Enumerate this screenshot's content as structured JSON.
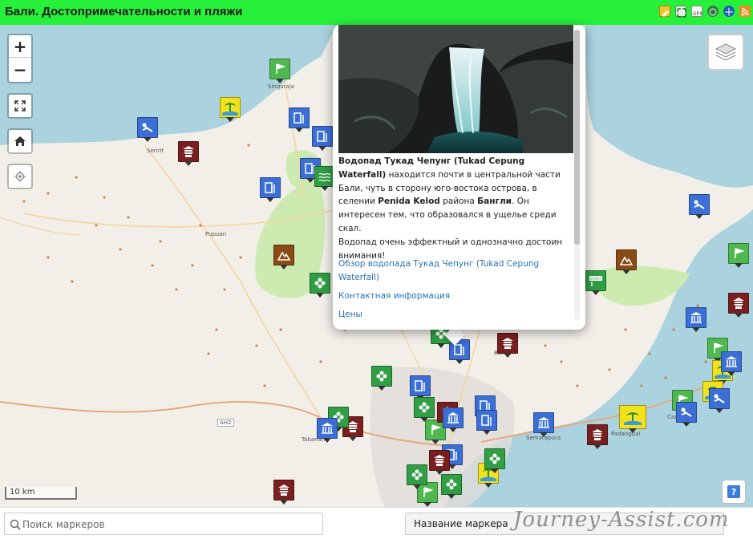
{
  "header": {
    "title": "Бали. Достопримечательности и пляжи",
    "icons": [
      "edit-icon",
      "fullscreen-icon",
      "gpx-icon",
      "globe-icon",
      "earth-icon",
      "rss-icon"
    ],
    "background": "#27f03a"
  },
  "map": {
    "controls": {
      "zoom_in": "+",
      "zoom_out": "−"
    },
    "scale_label": "10 km",
    "help_label": "?",
    "towns": [
      "Singaraja",
      "Seririt",
      "Pupuan",
      "Tabanan",
      "Bangli",
      "Semarapura",
      "Padangbai",
      "Candidasa",
      "AH2"
    ],
    "marker_categories": {
      "waterfall": "#3b6fd6",
      "temple": "#7a1f1f",
      "viewpoint": "#8a4a16",
      "flower": "#2f9e44",
      "flag": "#4fb84f",
      "diving": "#3b6fd6",
      "beach": "#f1e21b",
      "museum": "#3b6fd6"
    }
  },
  "popup": {
    "title_bold": "Водопад Тукад Чепунг (Tukad Cepung Waterfall)",
    "text_1": "находится почти в центральной части Бали, чуть в сторону юго-востока острова, в селении ",
    "village": "Penida Kelod",
    "text_2": " района ",
    "district": "Бангли",
    "text_3": ". Он интересен тем, что образовался в ущелье среди скал.",
    "text_4": "Водопад очень эффектный и однозначно достоин внимания!",
    "links": [
      "Обзор водопада Тукад Чепунг (Tukad Cepung Waterfall)",
      "Контактная информация",
      "Цены"
    ]
  },
  "footer": {
    "search_placeholder": "Поиск маркеров",
    "sort_label": "Название маркера",
    "watermark": "Journey-Assist.com"
  }
}
